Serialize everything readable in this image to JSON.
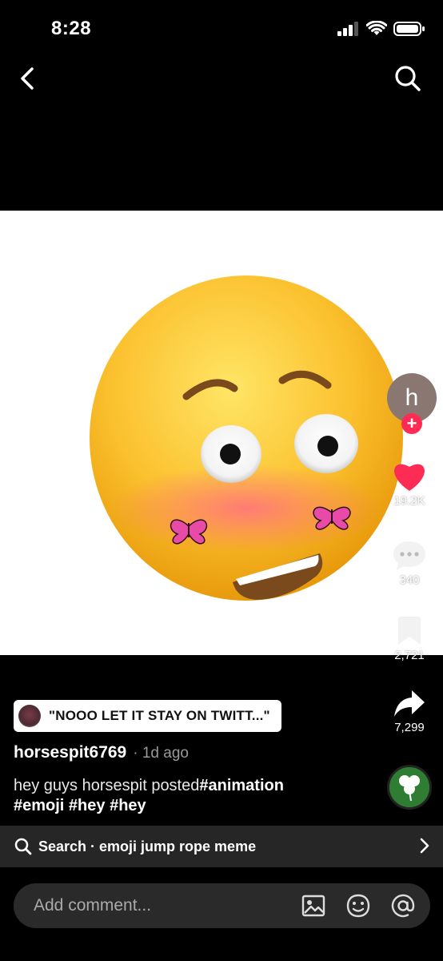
{
  "status": {
    "time": "8:28"
  },
  "video": {
    "emoji": "flushed-blushing-emoji-with-butterflies"
  },
  "creator": {
    "avatar_letter": "h"
  },
  "actions": {
    "likes": "19.2K",
    "comments": "340",
    "saves": "2,721",
    "shares": "7,299"
  },
  "sound": {
    "title": "\"NOOO LET IT STAY ON TWITT...\""
  },
  "post": {
    "author": "horsespit6769",
    "time_ago": "· 1d ago",
    "caption_text": "hey guys horsespit posted",
    "hashtag_1": "#animation",
    "hashtag_2": "#emoji",
    "hashtag_3": "#hey",
    "hashtag_4": "#hey"
  },
  "music_disc": {
    "label": "st. patricks day"
  },
  "search_suggestion": {
    "label": "Search · emoji jump rope meme"
  },
  "comment": {
    "placeholder": "Add comment..."
  },
  "colors": {
    "accent": "#fe2c55",
    "background": "#000000",
    "bar": "#262626"
  }
}
